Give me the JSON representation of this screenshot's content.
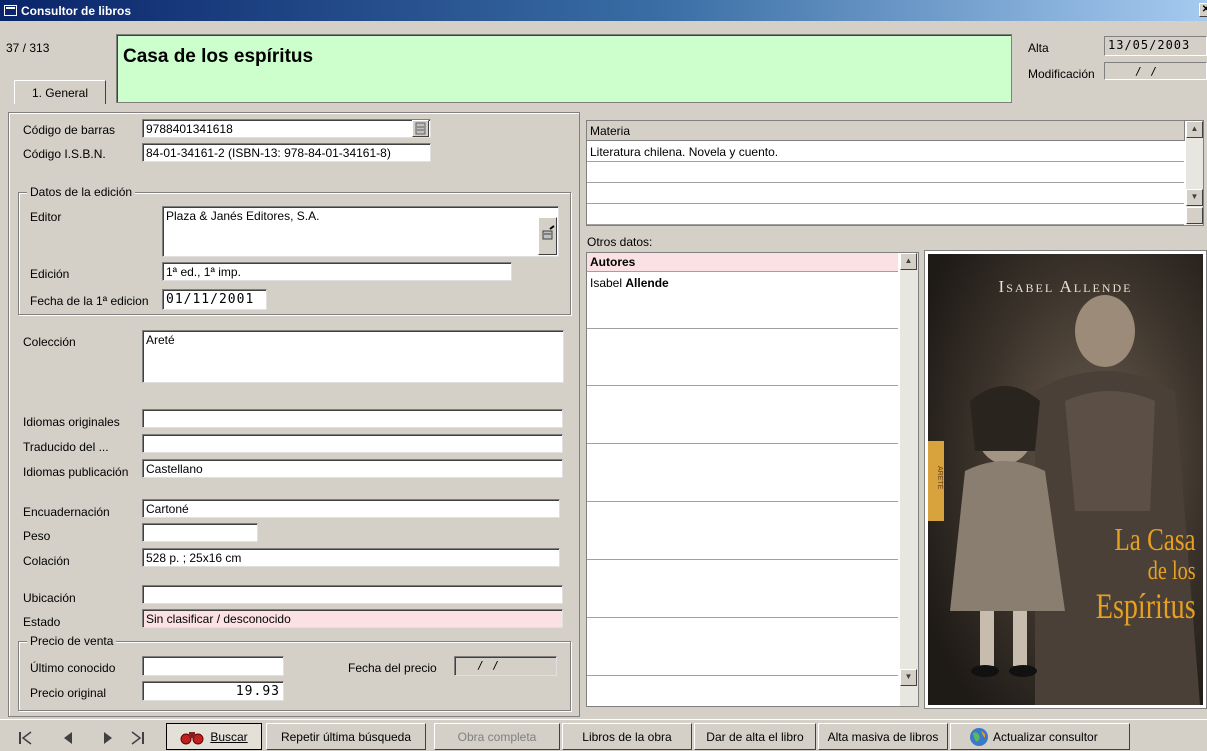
{
  "window": {
    "title": "Consultor de libros"
  },
  "record": {
    "position": "37 / 313",
    "title": "Casa de los espíritus"
  },
  "tabs": [
    {
      "label": "1. General"
    }
  ],
  "dates": {
    "alta_label": "Alta",
    "alta_value": "13/05/2003",
    "modificacion_label": "Modificación",
    "modificacion_value": "/ /"
  },
  "codes": {
    "barcode_label": "Código de barras",
    "barcode_value": "9788401341618",
    "isbn_label": "Código I.S.B.N.",
    "isbn_value": "84-01-34161-2    (ISBN-13: 978-84-01-34161-8)"
  },
  "edition": {
    "group_title": "Datos de la edición",
    "editor_label": "Editor",
    "editor_value": "Plaza & Janés Editores, S.A.",
    "edicion_label": "Edición",
    "edicion_value": "1ª ed., 1ª imp.",
    "fecha_label": "Fecha de la 1ª edicion",
    "fecha_value": "01/11/2001"
  },
  "coleccion": {
    "label": "Colección",
    "value": "Areté"
  },
  "idiomas": {
    "originales_label": "Idiomas originales",
    "originales_value": "",
    "traducido_label": "Traducido del ...",
    "traducido_value": "",
    "publicacion_label": "Idiomas publicación",
    "publicacion_value": "Castellano"
  },
  "fisico": {
    "encuadernacion_label": "Encuadernación",
    "encuadernacion_value": "Cartoné",
    "peso_label": "Peso",
    "peso_value": "",
    "colacion_label": "Colación",
    "colacion_value": "528 p. ; 25x16 cm"
  },
  "ubicacion": {
    "ubicacion_label": "Ubicación",
    "ubicacion_value": "",
    "estado_label": "Estado",
    "estado_value": "Sin clasificar / desconocido"
  },
  "precio": {
    "group_title": "Precio de venta",
    "ultimo_label": "Último conocido",
    "ultimo_value": "",
    "fecha_label": "Fecha del precio",
    "fecha_value": "/ /",
    "original_label": "Precio original",
    "original_value": "19.93"
  },
  "materia": {
    "header": "Materia",
    "rows": [
      "Literatura chilena. Novela y cuento.",
      "",
      "",
      ""
    ]
  },
  "otros": {
    "label": "Otros datos:",
    "header": "Autores",
    "author_first": "Isabel ",
    "author_last": "Allende"
  },
  "cover": {
    "author": "Isabel Allende",
    "title_line1": "La Casa",
    "title_line2": "de los",
    "title_line3": "Espíritus",
    "spine": "ARETÉ"
  },
  "toolbar": {
    "buscar": "Buscar",
    "repetir": "Repetir última búsqueda",
    "obra_completa": "Obra completa",
    "libros_obra": "Libros de la obra",
    "dar_alta": "Dar de alta el libro",
    "alta_masiva": "Alta masiva de libros",
    "actualizar": "Actualizar consultor"
  },
  "colors": {
    "title_bg": "#ccffcc",
    "estado_bg": "#fbe0e4",
    "autores_header_bg": "#fbe0e4",
    "window_bg": "#d4d0c8",
    "titlebar": "#0a246a"
  }
}
